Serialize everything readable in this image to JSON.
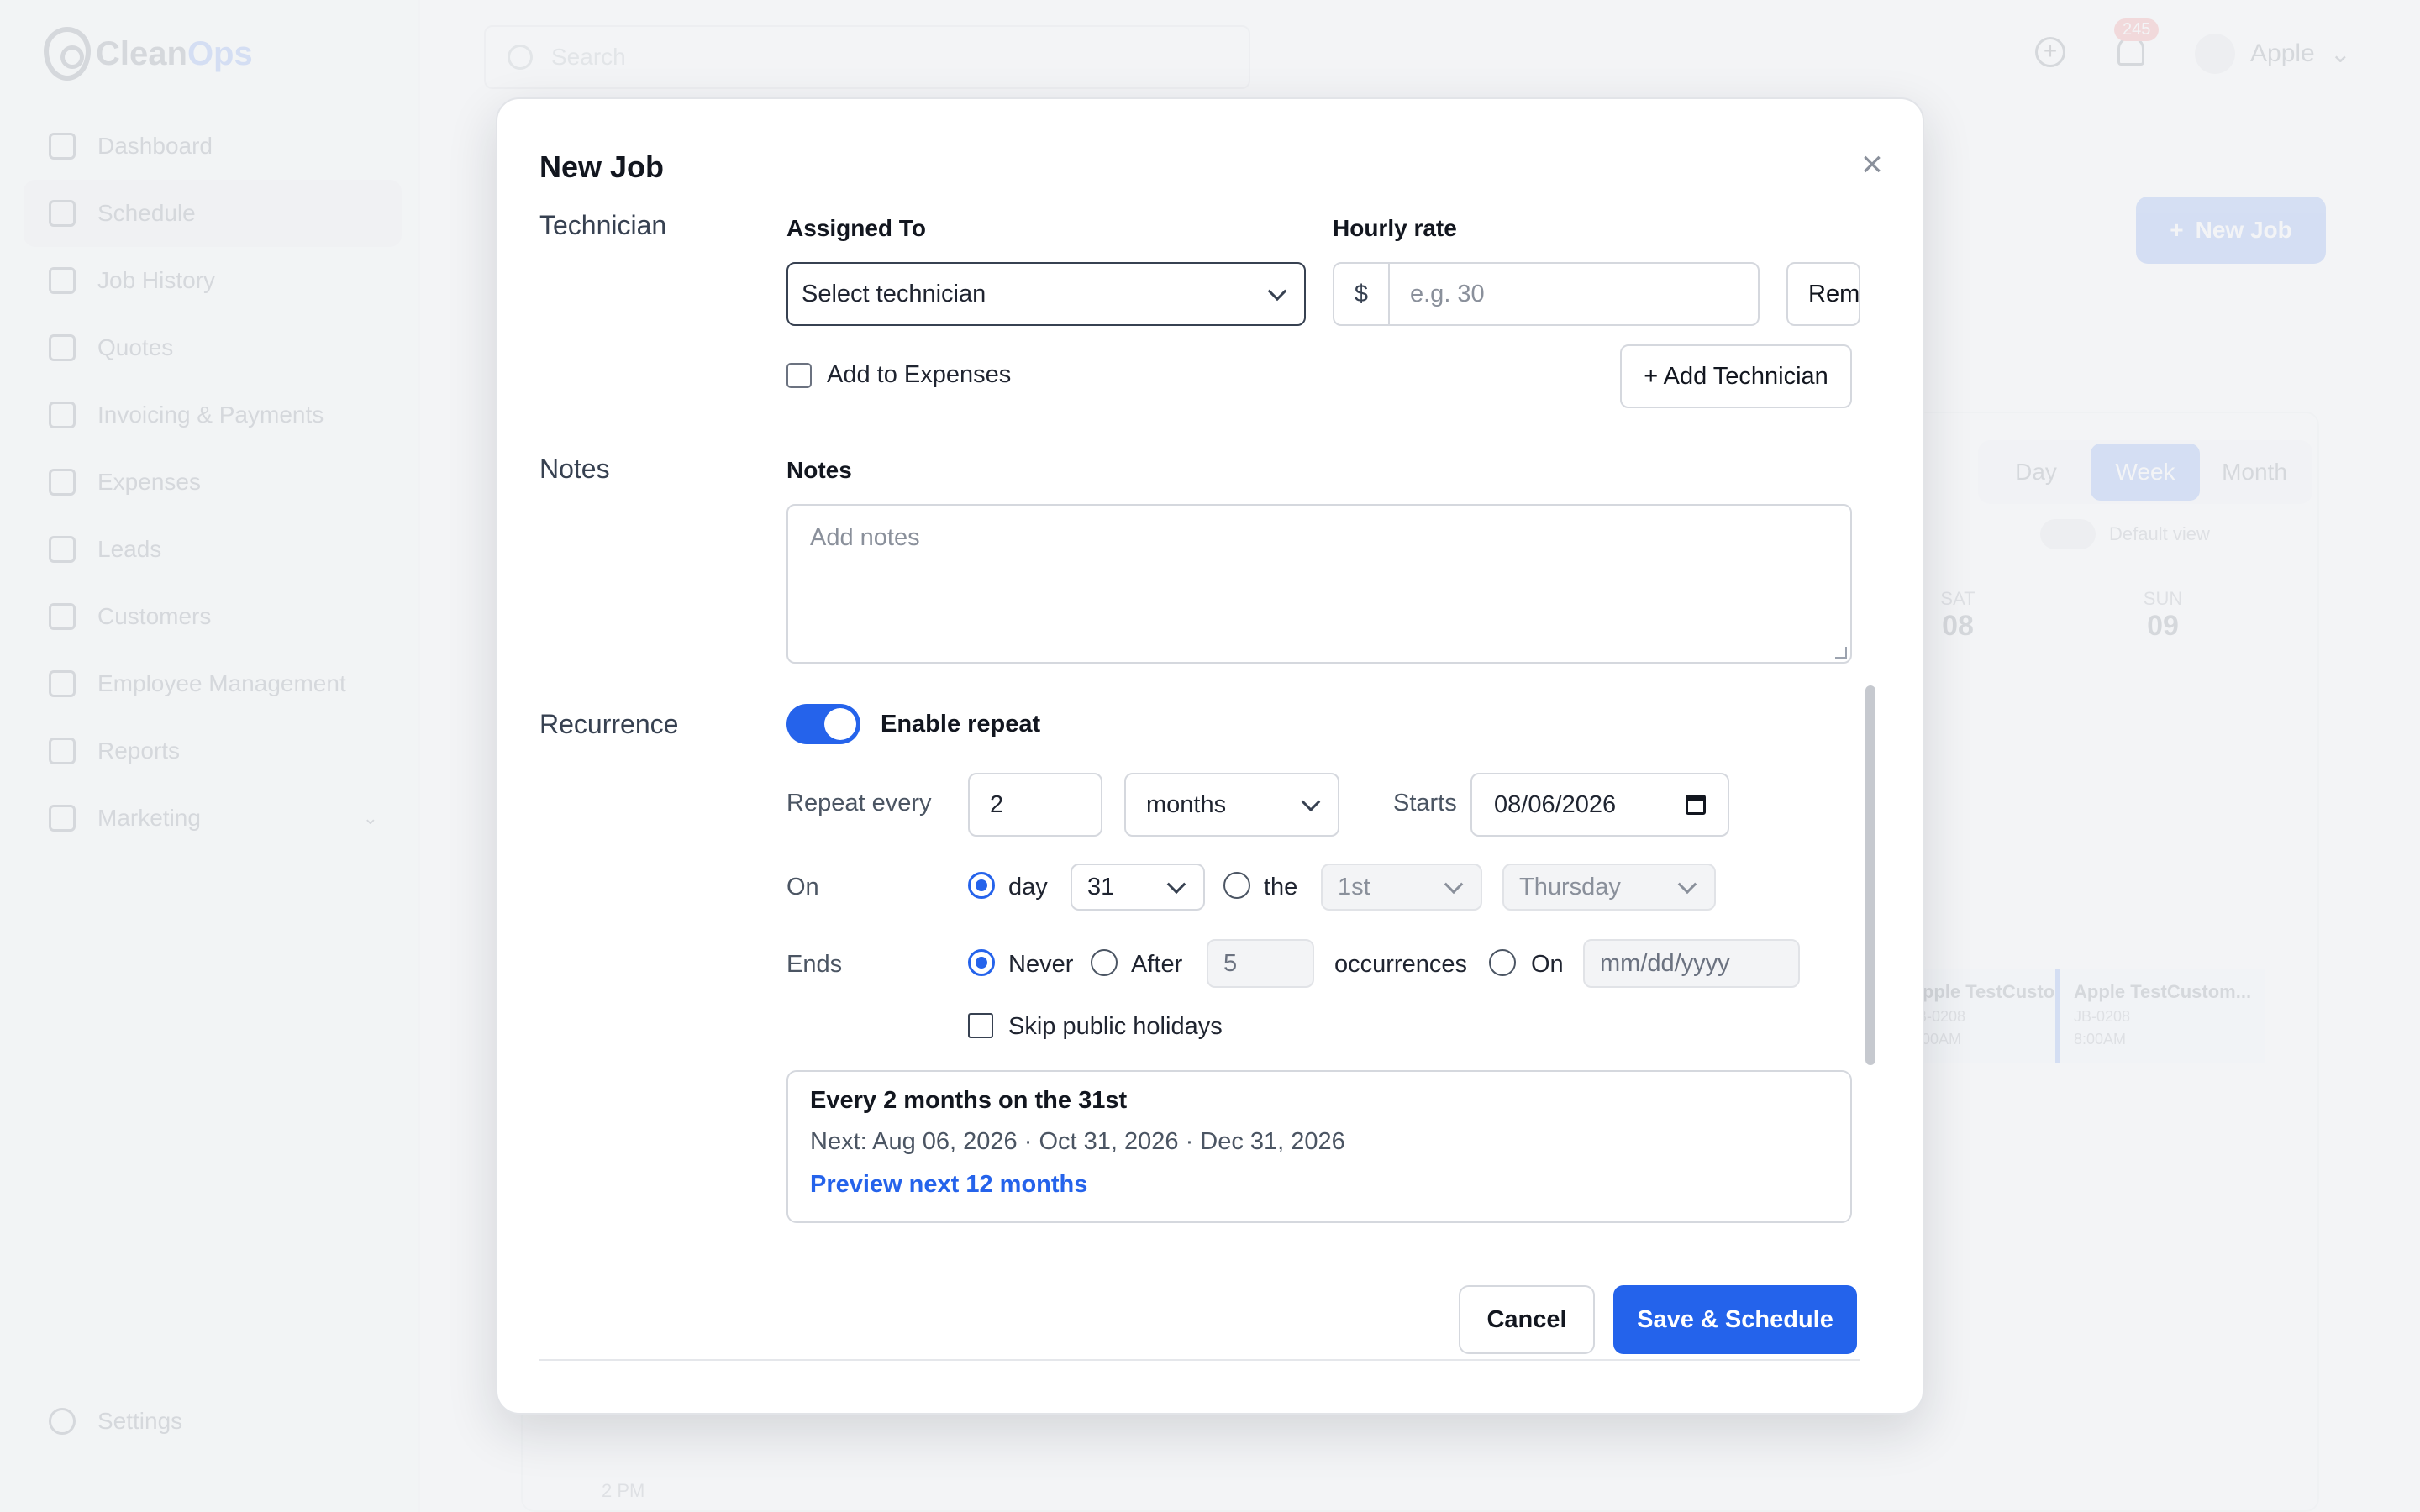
{
  "app": {
    "logo_clean": "Clean",
    "logo_ops": "Ops",
    "search_placeholder": "Search",
    "notification_count": "245",
    "user_name": "Apple",
    "new_job_button": "New Job",
    "nav": [
      {
        "label": "Dashboard",
        "icon": "home-icon"
      },
      {
        "label": "Schedule",
        "icon": "calendar-icon"
      },
      {
        "label": "Job History",
        "icon": "list-icon"
      },
      {
        "label": "Quotes",
        "icon": "document-icon"
      },
      {
        "label": "Invoicing & Payments",
        "icon": "dollar-icon"
      },
      {
        "label": "Expenses",
        "icon": "wallet-icon"
      },
      {
        "label": "Leads",
        "icon": "funnel-icon"
      },
      {
        "label": "Customers",
        "icon": "users-icon"
      },
      {
        "label": "Employee Management",
        "icon": "user-gear-icon"
      },
      {
        "label": "Reports",
        "icon": "chart-icon"
      },
      {
        "label": "Marketing",
        "icon": "megaphone-icon"
      }
    ],
    "settings_label": "Settings",
    "view_tabs": [
      "Day",
      "Week",
      "Month"
    ],
    "default_view_label": "Default view",
    "days": [
      {
        "name": "SAT",
        "date": "08"
      },
      {
        "name": "SUN",
        "date": "09"
      }
    ],
    "events": [
      {
        "title": "Apple TestCustom...",
        "job": "JB-0208",
        "time": "8:00AM"
      },
      {
        "title": "Apple TestCustom...",
        "job": "JB-0208",
        "time": "8:00AM"
      }
    ],
    "time_label": "2 PM"
  },
  "modal": {
    "title": "New Job",
    "technician_section": "Technician",
    "assigned_to_label": "Assigned To",
    "technician_select_value": "Select technician",
    "hourly_rate_label": "Hourly rate",
    "currency_symbol": "$",
    "hourly_rate_placeholder": "e.g. 30",
    "remove_button_partial": "Rem",
    "add_to_expenses_label": "Add to Expenses",
    "add_technician_button": "+ Add Technician",
    "notes_section": "Notes",
    "notes_label": "Notes",
    "notes_placeholder": "Add notes",
    "recurrence_section": "Recurrence",
    "enable_repeat_label": "Enable repeat",
    "repeat_every_label": "Repeat every",
    "repeat_interval": "2",
    "repeat_unit": "months",
    "starts_label": "Starts",
    "start_date": "08/06/2026",
    "on_label": "On",
    "day_option": "day",
    "day_value": "31",
    "the_option": "the",
    "ordinal_value": "1st",
    "weekday_value": "Thursday",
    "ends_label": "Ends",
    "never_option": "Never",
    "after_option": "After",
    "occurrences_value": "5",
    "occurrences_label": "occurrences",
    "on_date_option": "On",
    "end_date_placeholder": "mm/dd/yyyy",
    "skip_holidays_label": "Skip public holidays",
    "summary_title": "Every 2 months on the 31st",
    "summary_next": "Next: Aug 06, 2026 · Oct 31, 2026 · Dec 31, 2026",
    "preview_link": "Preview next 12 months",
    "cancel_button": "Cancel",
    "save_button": "Save & Schedule"
  },
  "colors": {
    "accent": "#2563eb",
    "badge": "#ef4444"
  }
}
